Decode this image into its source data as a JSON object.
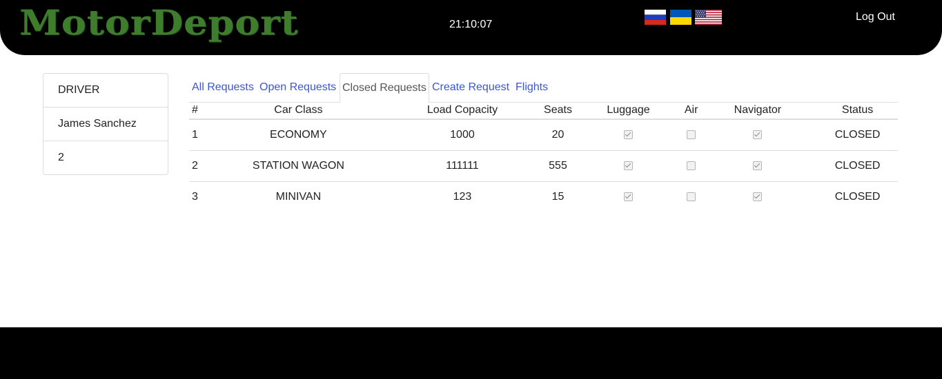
{
  "header": {
    "logo": "MotorDeport",
    "clock": "21:10:07",
    "flags": [
      {
        "name": "russian-flag-icon",
        "colors": [
          "#ffffff",
          "#1c3fbf",
          "#d52b1e"
        ]
      },
      {
        "name": "ukrainian-flag-icon",
        "colors": [
          "#0057b7",
          "#ffd700"
        ]
      },
      {
        "name": "us-flag-icon",
        "colors": [
          "#b22234",
          "#ffffff",
          "#3c3b6e"
        ]
      }
    ],
    "logout": "Log Out",
    "logo_color": "#3e7d2c"
  },
  "sidebar": {
    "items": [
      {
        "label": "DRIVER"
      },
      {
        "label": "James Sanchez"
      },
      {
        "label": "2"
      }
    ]
  },
  "tabs": [
    {
      "label": "All Requests",
      "active": false
    },
    {
      "label": "Open Requests",
      "active": false
    },
    {
      "label": "Closed Requests",
      "active": true
    },
    {
      "label": "Create Request",
      "active": false
    },
    {
      "label": "Flights",
      "active": false
    }
  ],
  "table": {
    "headers": [
      "#",
      "Car Class",
      "Load Copacity",
      "Seats",
      "Luggage",
      "Air",
      "Navigator",
      "Status"
    ],
    "rows": [
      {
        "num": "1",
        "car_class": "ECONOMY",
        "load": "1000",
        "seats": "20",
        "luggage": true,
        "air": false,
        "navigator": true,
        "status": "CLOSED"
      },
      {
        "num": "2",
        "car_class": "STATION WAGON",
        "load": "111111",
        "seats": "555",
        "luggage": true,
        "air": false,
        "navigator": true,
        "status": "CLOSED"
      },
      {
        "num": "3",
        "car_class": "MINIVAN",
        "load": "123",
        "seats": "15",
        "luggage": true,
        "air": false,
        "navigator": true,
        "status": "CLOSED"
      }
    ]
  },
  "colors": {
    "link": "#3a55d6",
    "header_bg": "#000000",
    "border": "#dddddd"
  }
}
